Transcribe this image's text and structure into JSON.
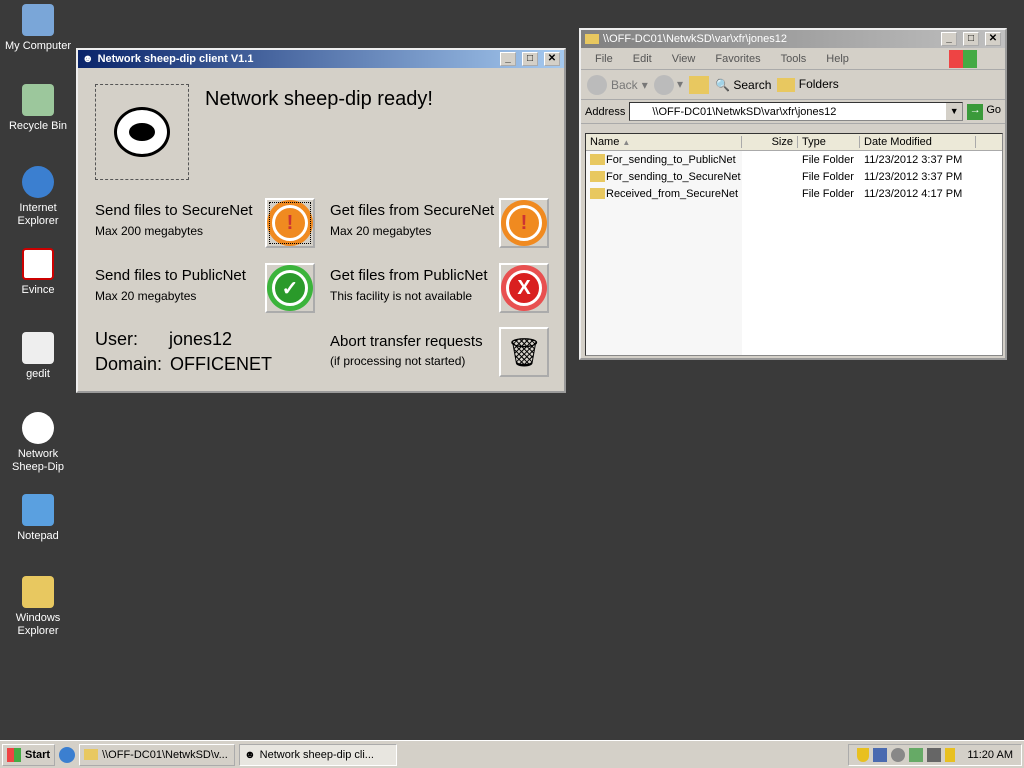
{
  "desktop_icons": [
    {
      "label": "My Computer"
    },
    {
      "label": "Recycle Bin"
    },
    {
      "label": "Internet Explorer"
    },
    {
      "label": "Evince"
    },
    {
      "label": "gedit"
    },
    {
      "label": "Network Sheep-Dip"
    },
    {
      "label": "Notepad"
    },
    {
      "label": "Windows Explorer"
    }
  ],
  "client": {
    "title": "Network sheep-dip client V1.1",
    "status": "Network sheep-dip ready!",
    "send_secure": {
      "label": "Send files to SecureNet",
      "sub": "Max 200 megabytes"
    },
    "get_secure": {
      "label": "Get files from SecureNet",
      "sub": "Max 20 megabytes"
    },
    "send_public": {
      "label": "Send files to PublicNet",
      "sub": "Max 20 megabytes"
    },
    "get_public": {
      "label": "Get files from PublicNet",
      "sub": "This facility is not available"
    },
    "user_label": "User:",
    "user": "jones12",
    "domain_label": "Domain:",
    "domain": "OFFICENET",
    "abort": {
      "label": "Abort transfer requests",
      "sub": "(if processing not started)"
    }
  },
  "explorer": {
    "title": "\\\\OFF-DC01\\NetwkSD\\var\\xfr\\jones12",
    "menu": [
      "File",
      "Edit",
      "View",
      "Favorites",
      "Tools",
      "Help"
    ],
    "toolbar": {
      "back": "Back",
      "search": "Search",
      "folders": "Folders"
    },
    "address_label": "Address",
    "address": "\\\\OFF-DC01\\NetwkSD\\var\\xfr\\jones12",
    "go": "Go",
    "columns": [
      "Name",
      "Size",
      "Type",
      "Date Modified"
    ],
    "rows": [
      [
        "For_sending_to_PublicNet",
        "",
        "File Folder",
        "11/23/2012 3:37 PM"
      ],
      [
        "For_sending_to_SecureNet",
        "",
        "File Folder",
        "11/23/2012 3:37 PM"
      ],
      [
        "Received_from_SecureNet",
        "",
        "File Folder",
        "11/23/2012 4:17 PM"
      ]
    ]
  },
  "taskbar": {
    "start": "Start",
    "tasks": [
      "\\\\OFF-DC01\\NetwkSD\\v...",
      "Network sheep-dip cli..."
    ],
    "clock": "11:20 AM"
  }
}
